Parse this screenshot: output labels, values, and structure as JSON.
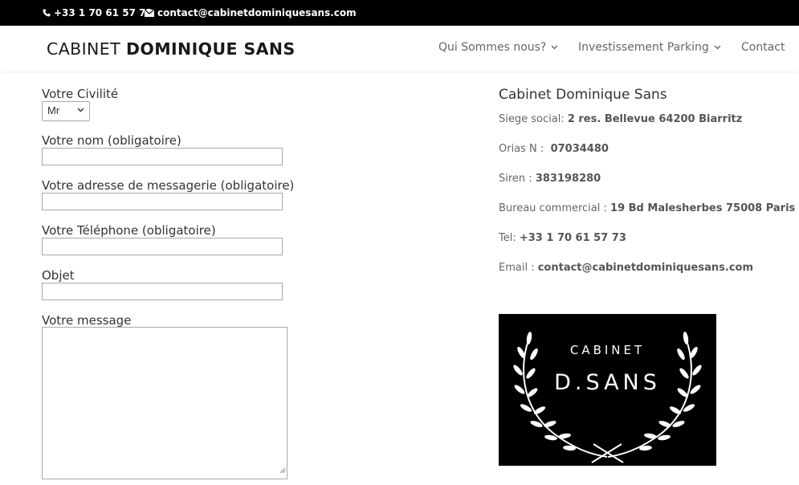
{
  "topbar": {
    "phone": "+33 1 70 61 57 73",
    "email": "contact@cabinetdominiquesans.com",
    "phone_icon": "phone-icon",
    "email_icon": "envelope-icon"
  },
  "header": {
    "logo_light": "CABINET ",
    "logo_bold": "DOMINIQUE SANS",
    "nav": [
      {
        "label": "Qui Sommes nous?",
        "icon": "chevron-down-icon"
      },
      {
        "label": "Investissement Parking",
        "icon": "chevron-down-icon"
      },
      {
        "label": "Contact"
      }
    ]
  },
  "form": {
    "civilite_label": "Votre Civilité",
    "civilite_value": "Mr",
    "nom_label": "Votre nom (obligatoire)",
    "email_label": "Votre adresse de messagerie (obligatoire)",
    "telephone_label": "Votre Téléphone (obligatoire)",
    "objet_label": "Objet",
    "message_label": "Votre message"
  },
  "sidebar": {
    "title": "Cabinet Dominique Sans",
    "siege_label": "Siege social: ",
    "siege_value": "2 res. Bellevue 64200 Biarritz",
    "orias_label": "Orias N :  ",
    "orias_value": "07034480",
    "siren_label": "Siren : ",
    "siren_value": "383198280",
    "bureau_label": "Bureau commercial : ",
    "bureau_value": "19 Bd Malesherbes 75008 Paris",
    "tel_label": "Tel: ",
    "tel_value": "+33 1 70 61 57 73",
    "email_label": "Email : ",
    "email_value": "contact@cabinetdominiquesans.com"
  },
  "logo_image": {
    "line1": "CABINET",
    "line2": "D.SANS",
    "bg_color": "#000000",
    "fg_color": "#ffffff"
  }
}
